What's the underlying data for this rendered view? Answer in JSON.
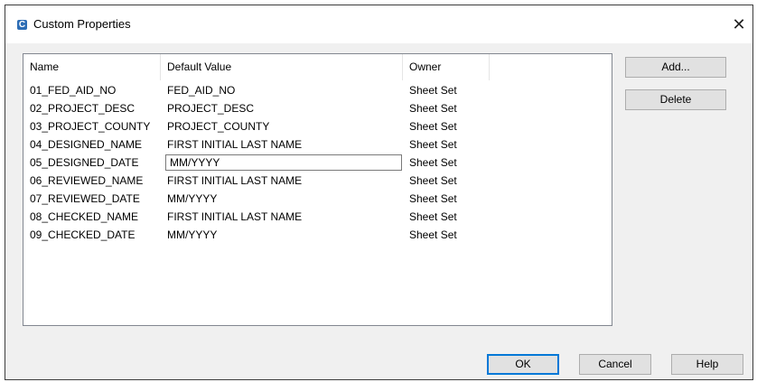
{
  "window": {
    "title": "Custom Properties",
    "close_symbol": "✕",
    "icon_letter": "C"
  },
  "list": {
    "headers": {
      "name": "Name",
      "default_value": "Default Value",
      "owner": "Owner"
    },
    "rows": [
      {
        "name": "01_FED_AID_NO",
        "default_value": "FED_AID_NO",
        "owner": "Sheet Set"
      },
      {
        "name": "02_PROJECT_DESC",
        "default_value": "PROJECT_DESC",
        "owner": "Sheet Set"
      },
      {
        "name": "03_PROJECT_COUNTY",
        "default_value": "PROJECT_COUNTY",
        "owner": "Sheet Set"
      },
      {
        "name": "04_DESIGNED_NAME",
        "default_value": "FIRST INITIAL LAST NAME",
        "owner": "Sheet Set"
      },
      {
        "name": "05_DESIGNED_DATE",
        "default_value": "MM/YYYY",
        "owner": "Sheet Set"
      },
      {
        "name": "06_REVIEWED_NAME",
        "default_value": "FIRST INITIAL LAST NAME",
        "owner": "Sheet Set"
      },
      {
        "name": "07_REVIEWED_DATE",
        "default_value": "MM/YYYY",
        "owner": "Sheet Set"
      },
      {
        "name": "08_CHECKED_NAME",
        "default_value": "FIRST INITIAL LAST NAME",
        "owner": "Sheet Set"
      },
      {
        "name": "09_CHECKED_DATE",
        "default_value": "MM/YYYY",
        "owner": "Sheet Set"
      }
    ]
  },
  "buttons": {
    "add": "Add...",
    "delete": "Delete",
    "ok": "OK",
    "cancel": "Cancel",
    "help": "Help"
  },
  "colors": {
    "accent": "#0078d7",
    "app_icon": "#2d6db5"
  }
}
